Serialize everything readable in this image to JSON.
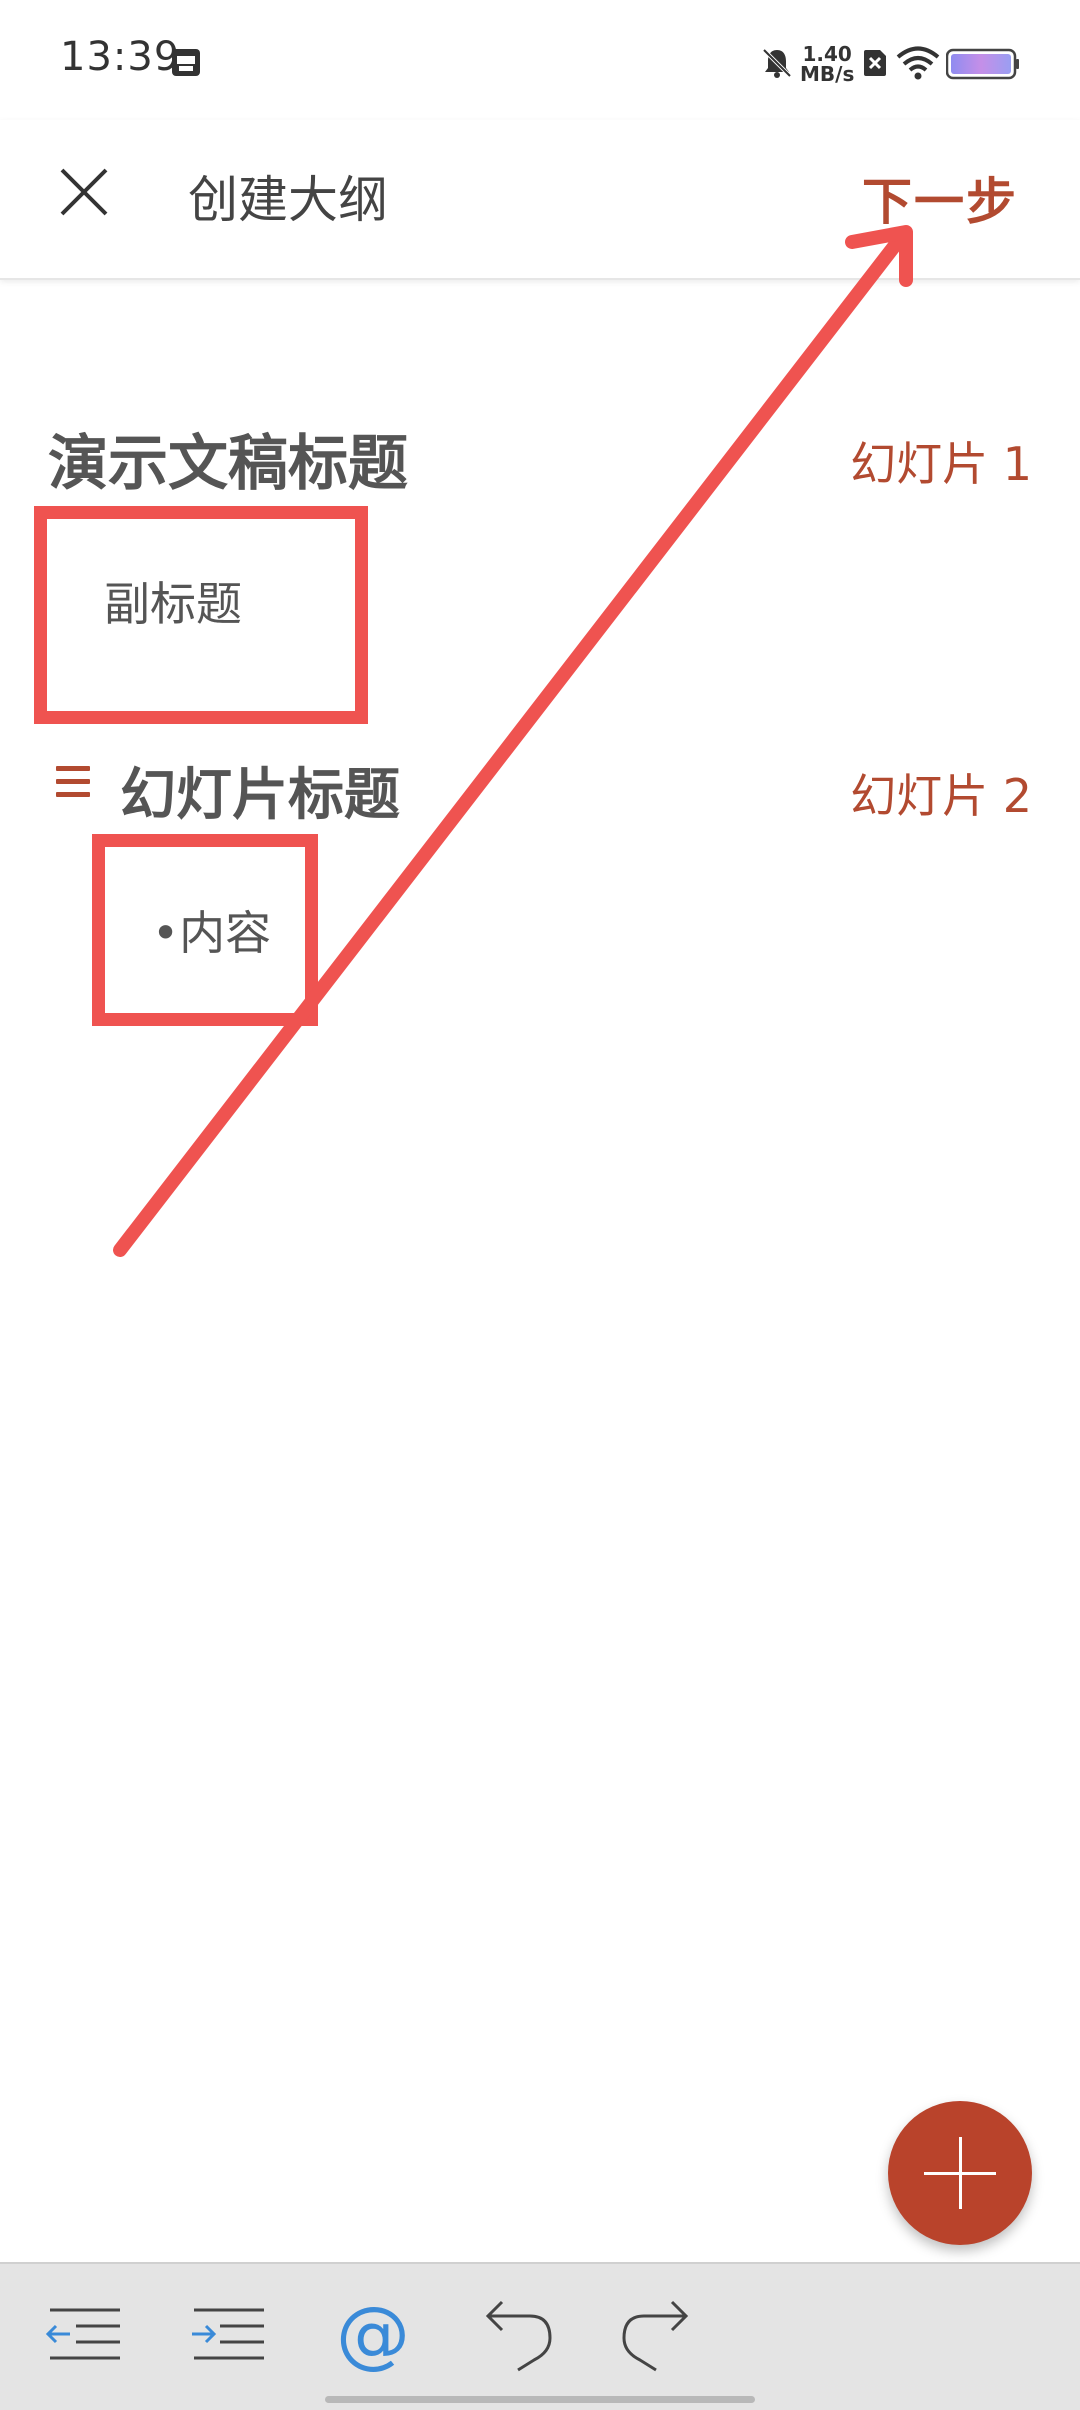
{
  "status_bar": {
    "time": "13:39",
    "net_speed_value": "1.40",
    "net_speed_unit": "MB/s",
    "icons": [
      "calendar-icon",
      "mute-icon",
      "sim-off-icon",
      "wifi-icon",
      "battery-icon"
    ]
  },
  "app_bar": {
    "title": "创建大纲",
    "close_icon": "close-icon",
    "next_label": "下一步"
  },
  "outline": {
    "presentation_title": "演示文稿标题",
    "slide1_label": "幻灯片 1",
    "subtitle": "副标题",
    "slide2_title": "幻灯片标题",
    "slide2_label": "幻灯片 2",
    "slide2_content": "•内容"
  },
  "fab": {
    "icon": "plus-icon"
  },
  "toolbar": {
    "items": [
      "outdent-icon",
      "indent-icon",
      "at-icon",
      "undo-icon",
      "redo-icon"
    ],
    "at_label": "@"
  },
  "colors": {
    "accent": "#b24a30",
    "annotation": "#ef5350",
    "fab": "#b9432b",
    "toolbar_bg": "#e4e4e4"
  }
}
